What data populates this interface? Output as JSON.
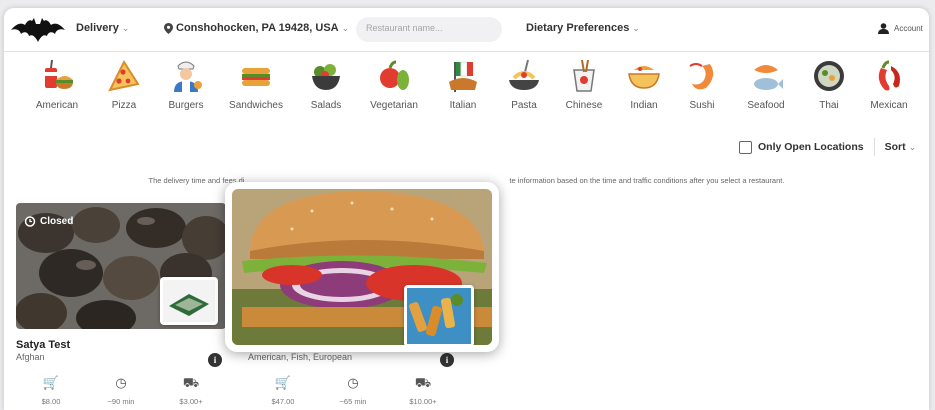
{
  "header": {
    "delivery_label": "Delivery",
    "location": "Conshohocken, PA 19428, USA",
    "search_placeholder": "Restaurant name...",
    "dietary_label": "Dietary Preferences",
    "account_label": "Account"
  },
  "categories": [
    {
      "label": "American",
      "icon": "american-food-icon"
    },
    {
      "label": "Pizza",
      "icon": "pizza-icon"
    },
    {
      "label": "Burgers",
      "icon": "burger-chef-icon"
    },
    {
      "label": "Sandwiches",
      "icon": "sandwich-icon"
    },
    {
      "label": "Salads",
      "icon": "salad-icon"
    },
    {
      "label": "Vegetarian",
      "icon": "vegetables-icon"
    },
    {
      "label": "Italian",
      "icon": "italian-icon"
    },
    {
      "label": "Pasta",
      "icon": "pasta-icon"
    },
    {
      "label": "Chinese",
      "icon": "chinese-takeout-icon"
    },
    {
      "label": "Indian",
      "icon": "indian-curry-icon"
    },
    {
      "label": "Sushi",
      "icon": "shrimp-icon"
    },
    {
      "label": "Seafood",
      "icon": "seafood-icon"
    },
    {
      "label": "Thai",
      "icon": "thai-bowl-icon"
    },
    {
      "label": "Mexican",
      "icon": "chili-pepper-icon"
    }
  ],
  "filters": {
    "open_only_label": "Only Open Locations",
    "sort_label": "Sort"
  },
  "notice": {
    "left": "The delivery time and fees di",
    "right": "te information based on the time and traffic conditions after you select a restaurant."
  },
  "restaurants": [
    {
      "name": "Satya Test",
      "cuisine": "Afghan",
      "status": "Closed",
      "minimum": "$8.00",
      "time": "~90 min",
      "fee": "$3.00+"
    },
    {
      "name": "",
      "cuisine": "American, Fish, European",
      "status": "",
      "minimum": "$47.00",
      "time": "~65 min",
      "fee": "$10.00+"
    }
  ],
  "colors": {
    "accent_red": "#e23c30",
    "text_dark": "#2b2b2b",
    "page_bg": "#ececef"
  }
}
